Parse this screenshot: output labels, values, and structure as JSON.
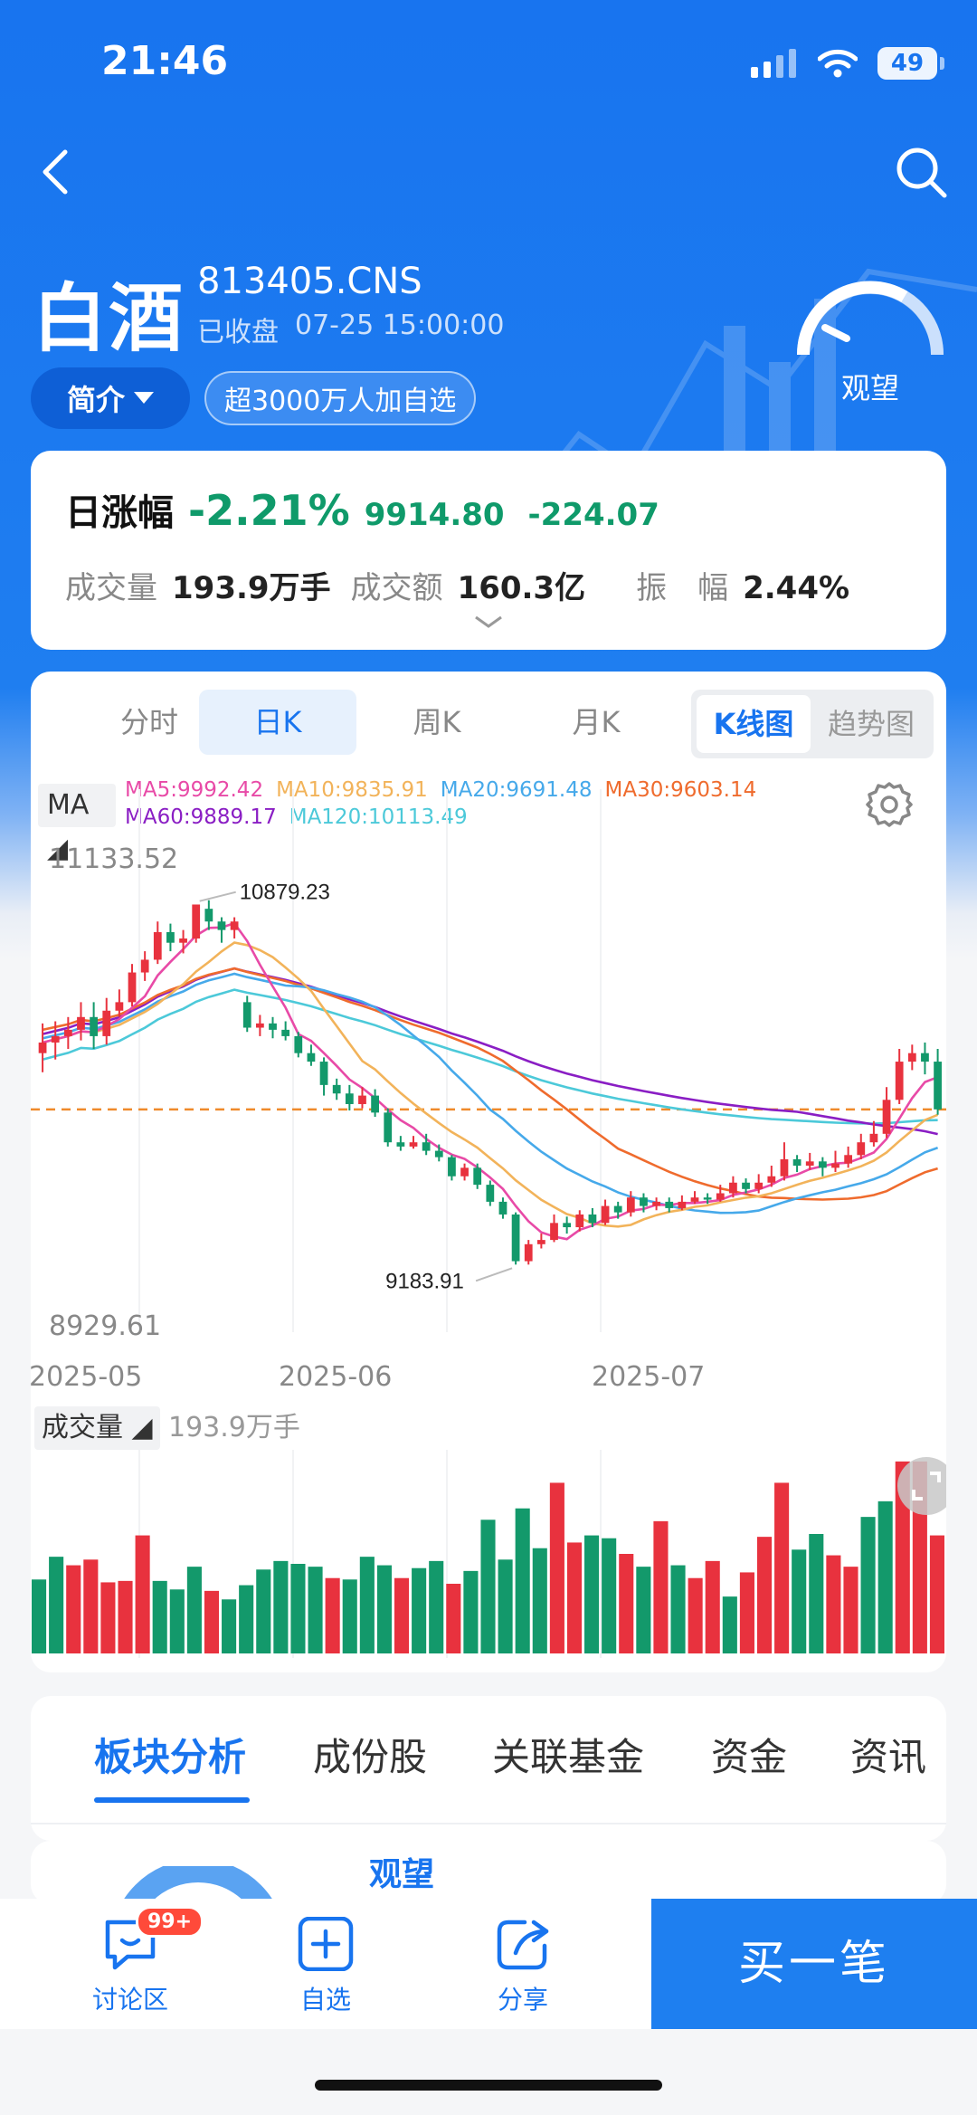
{
  "status": {
    "time": "21:46",
    "battery": "49"
  },
  "header": {
    "title": "白酒",
    "code": "813405.CNS",
    "state": "已收盘",
    "datetime": "07-25 15:00:00",
    "intro_label": "简介",
    "watch_count": "超3000万人加自选",
    "sentiment": "观望"
  },
  "quote": {
    "label": "日涨幅",
    "pct": "-2.21%",
    "price": "9914.80",
    "change": "-224.07",
    "volume_label": "成交量",
    "volume": "193.9万手",
    "amount_label": "成交额",
    "amount": "160.3亿",
    "amp_label": "振　幅",
    "amp": "2.44%"
  },
  "chart_tabs": {
    "t1": "分时",
    "t2": "日K",
    "t3": "周K",
    "t4": "月K",
    "kline": "K线图",
    "trend": "趋势图"
  },
  "ma": {
    "label": "MA",
    "ma5": "MA5:9992.42",
    "ma10": "MA10:9835.91",
    "ma20": "MA20:9691.48",
    "ma30": "MA30:9603.14",
    "ma60": "MA60:9889.17",
    "ma120": "MA120:10113.49"
  },
  "colors": {
    "up": "#e8323e",
    "down": "#13996b",
    "ma5": "#e84aa7",
    "ma10": "#f2b35a",
    "ma20": "#46a9ea",
    "ma30": "#ef6b2d",
    "ma60": "#8a1ec4",
    "ma120": "#4cc9d9",
    "accent": "#1874ef"
  },
  "chart_data": {
    "type": "candlestick",
    "y_top": "11133.52",
    "y_bottom": "8929.61",
    "ylim": [
      8929.61,
      11133.52
    ],
    "high_label": "10879.23",
    "low_label": "9183.91",
    "x_ticks": [
      "2025-05",
      "2025-06",
      "2025-07"
    ],
    "last_close": 9914.8,
    "candles": [
      [
        10180,
        10230,
        10320,
        10090
      ],
      [
        10230,
        10260,
        10330,
        10150
      ],
      [
        10260,
        10290,
        10350,
        10200
      ],
      [
        10290,
        10350,
        10420,
        10240
      ],
      [
        10350,
        10260,
        10420,
        10200
      ],
      [
        10260,
        10380,
        10440,
        10220
      ],
      [
        10380,
        10420,
        10480,
        10350
      ],
      [
        10420,
        10560,
        10600,
        10400
      ],
      [
        10560,
        10620,
        10660,
        10520
      ],
      [
        10620,
        10750,
        10800,
        10600
      ],
      [
        10750,
        10700,
        10790,
        10660
      ],
      [
        10700,
        10720,
        10760,
        10650
      ],
      [
        10720,
        10880,
        10879,
        10700
      ],
      [
        10860,
        10800,
        10900,
        10760
      ],
      [
        10800,
        10760,
        10820,
        10700
      ],
      [
        10760,
        10800,
        10820,
        10720
      ],
      [
        10420,
        10300,
        10450,
        10280
      ],
      [
        10300,
        10320,
        10360,
        10260
      ],
      [
        10320,
        10290,
        10350,
        10250
      ],
      [
        10290,
        10260,
        10330,
        10240
      ],
      [
        10260,
        10180,
        10280,
        10160
      ],
      [
        10180,
        10140,
        10220,
        10120
      ],
      [
        10140,
        10030,
        10160,
        9980
      ],
      [
        10030,
        9990,
        10060,
        9960
      ],
      [
        9990,
        9940,
        10030,
        9910
      ],
      [
        9940,
        9980,
        10020,
        9920
      ],
      [
        9980,
        9900,
        10010,
        9880
      ],
      [
        9900,
        9760,
        9920,
        9740
      ],
      [
        9760,
        9740,
        9790,
        9720
      ],
      [
        9740,
        9760,
        9790,
        9730
      ],
      [
        9760,
        9720,
        9800,
        9700
      ],
      [
        9720,
        9690,
        9750,
        9670
      ],
      [
        9690,
        9600,
        9700,
        9580
      ],
      [
        9600,
        9640,
        9660,
        9580
      ],
      [
        9640,
        9560,
        9660,
        9540
      ],
      [
        9560,
        9480,
        9580,
        9460
      ],
      [
        9480,
        9420,
        9500,
        9400
      ],
      [
        9420,
        9200,
        9430,
        9184
      ],
      [
        9200,
        9280,
        9300,
        9184
      ],
      [
        9280,
        9300,
        9330,
        9260
      ],
      [
        9300,
        9380,
        9420,
        9290
      ],
      [
        9380,
        9360,
        9410,
        9330
      ],
      [
        9360,
        9420,
        9440,
        9340
      ],
      [
        9420,
        9380,
        9450,
        9360
      ],
      [
        9380,
        9460,
        9490,
        9370
      ],
      [
        9460,
        9430,
        9480,
        9400
      ],
      [
        9430,
        9500,
        9530,
        9410
      ],
      [
        9500,
        9460,
        9520,
        9430
      ],
      [
        9460,
        9480,
        9500,
        9440
      ],
      [
        9480,
        9450,
        9500,
        9430
      ],
      [
        9450,
        9480,
        9510,
        9440
      ],
      [
        9480,
        9500,
        9530,
        9470
      ],
      [
        9500,
        9490,
        9520,
        9470
      ],
      [
        9490,
        9520,
        9560,
        9480
      ],
      [
        9520,
        9570,
        9600,
        9500
      ],
      [
        9570,
        9540,
        9590,
        9520
      ],
      [
        9540,
        9570,
        9610,
        9520
      ],
      [
        9570,
        9600,
        9650,
        9550
      ],
      [
        9600,
        9680,
        9760,
        9580
      ],
      [
        9680,
        9650,
        9700,
        9620
      ],
      [
        9650,
        9670,
        9710,
        9630
      ],
      [
        9670,
        9640,
        9690,
        9600
      ],
      [
        9640,
        9660,
        9720,
        9620
      ],
      [
        9660,
        9700,
        9740,
        9640
      ],
      [
        9700,
        9760,
        9800,
        9680
      ],
      [
        9760,
        9800,
        9860,
        9740
      ],
      [
        9800,
        9960,
        10020,
        9780
      ],
      [
        9960,
        10140,
        10200,
        9940
      ],
      [
        10140,
        10180,
        10220,
        10100
      ],
      [
        10180,
        10140,
        10230,
        10080
      ],
      [
        10140,
        9915,
        10200,
        9890
      ]
    ],
    "volumes": [
      [
        5.2,
        0
      ],
      [
        6.8,
        0
      ],
      [
        6.2,
        1
      ],
      [
        6.6,
        1
      ],
      [
        5.0,
        1
      ],
      [
        5.1,
        1
      ],
      [
        8.3,
        1
      ],
      [
        5.1,
        0
      ],
      [
        4.5,
        0
      ],
      [
        6.1,
        0
      ],
      [
        4.4,
        1
      ],
      [
        3.8,
        0
      ],
      [
        4.8,
        0
      ],
      [
        5.9,
        0
      ],
      [
        6.5,
        0
      ],
      [
        6.3,
        0
      ],
      [
        6.1,
        0
      ],
      [
        5.3,
        1
      ],
      [
        5.2,
        0
      ],
      [
        6.8,
        0
      ],
      [
        6.2,
        0
      ],
      [
        5.3,
        1
      ],
      [
        6.0,
        0
      ],
      [
        6.5,
        0
      ],
      [
        4.9,
        1
      ],
      [
        5.8,
        0
      ],
      [
        9.4,
        0
      ],
      [
        6.6,
        0
      ],
      [
        10.2,
        0
      ],
      [
        7.4,
        0
      ],
      [
        12.0,
        1
      ],
      [
        7.8,
        1
      ],
      [
        8.3,
        0
      ],
      [
        8.1,
        0
      ],
      [
        7.0,
        1
      ],
      [
        6.1,
        0
      ],
      [
        9.3,
        1
      ],
      [
        6.2,
        0
      ],
      [
        5.3,
        1
      ],
      [
        6.5,
        1
      ],
      [
        4.0,
        0
      ],
      [
        5.7,
        1
      ],
      [
        8.2,
        1
      ],
      [
        12.0,
        1
      ],
      [
        7.3,
        0
      ],
      [
        8.4,
        0
      ],
      [
        6.9,
        1
      ],
      [
        6.1,
        1
      ],
      [
        9.6,
        0
      ],
      [
        10.7,
        0
      ],
      [
        13.5,
        1
      ],
      [
        13.5,
        1
      ],
      [
        8.3,
        1
      ]
    ]
  },
  "volume_panel": {
    "label": "成交量",
    "value": "193.9万手"
  },
  "sections": {
    "s1": "板块分析",
    "s2": "成份股",
    "s3": "关联基金",
    "s4": "资金",
    "s5": "资讯",
    "sentiment": "观望"
  },
  "bottom": {
    "discuss": "讨论区",
    "badge": "99+",
    "watch": "自选",
    "share": "分享",
    "buy": "买一笔"
  }
}
